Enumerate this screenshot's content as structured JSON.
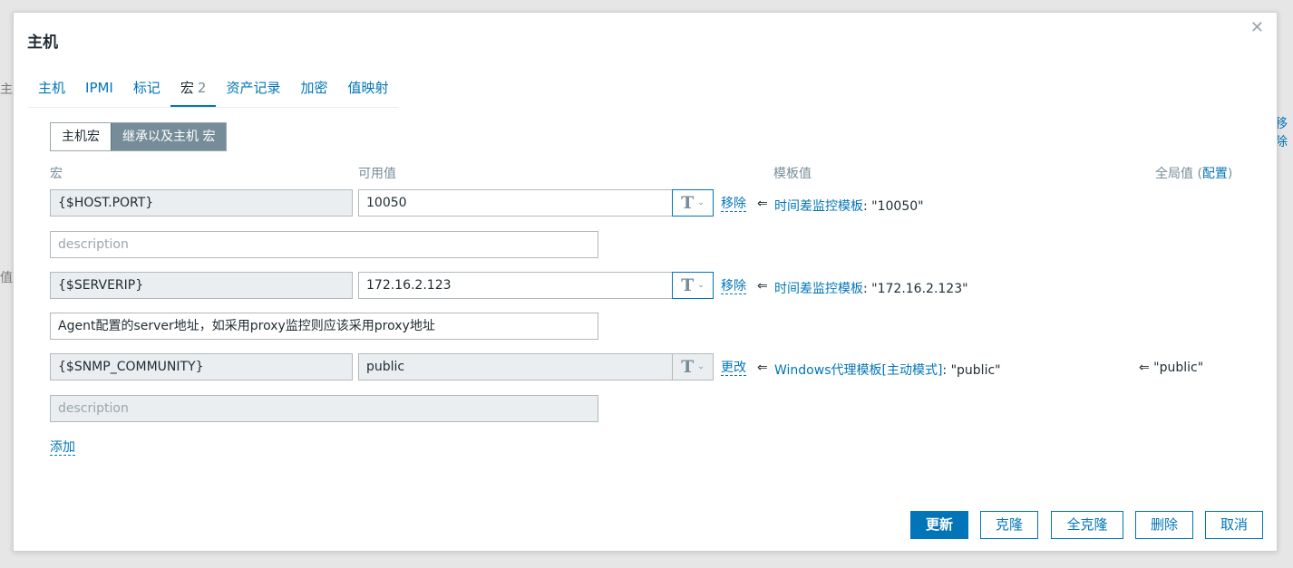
{
  "background": {
    "left_text_1": "主机",
    "left_text_2": "值",
    "right_text": "移除"
  },
  "modal": {
    "title": "主机",
    "tabs": [
      {
        "label": "主机"
      },
      {
        "label": "IPMI"
      },
      {
        "label": "标记"
      },
      {
        "label": "宏",
        "count": "2"
      },
      {
        "label": "资产记录"
      },
      {
        "label": "加密"
      },
      {
        "label": "值映射"
      }
    ],
    "segment": {
      "host_macros": "主机宏",
      "inherited_macros": "继承以及主机 宏"
    },
    "headers": {
      "macro": "宏",
      "effective_value": "可用值",
      "template_value": "模板值",
      "global_value": "全局值",
      "config_link": "配置"
    },
    "rows": [
      {
        "macro": "{$HOST.PORT}",
        "value": "10050",
        "description": "",
        "description_placeholder": "description",
        "action": "移除",
        "arrow": "⇐",
        "template_name": "时间差监控模板",
        "template_value": ": \"10050\"",
        "global_value": ""
      },
      {
        "macro": "{$SERVERIP}",
        "value": "172.16.2.123",
        "description": "Agent配置的server地址，如采用proxy监控则应该采用proxy地址",
        "description_placeholder": "description",
        "action": "移除",
        "arrow": "⇐",
        "template_name": "时间差监控模板",
        "template_value": ": \"172.16.2.123\"",
        "global_value": ""
      },
      {
        "macro": "{$SNMP_COMMUNITY}",
        "value": "public",
        "description": "",
        "description_placeholder": "description",
        "action": "更改",
        "arrow": "⇐",
        "template_name": "Windows代理模板[主动模式]",
        "template_value": ": \"public\"",
        "global_value": "⇐ \"public\""
      }
    ],
    "add_link": "添加",
    "buttons": {
      "update": "更新",
      "clone": "克隆",
      "full_clone": "全克隆",
      "delete": "删除",
      "cancel": "取消"
    },
    "icons": {
      "close": "close-icon",
      "text_type": "text-type-icon",
      "chevron": "chevron-down-icon"
    },
    "colors": {
      "accent": "#0275b8",
      "muted": "#768d99",
      "readonly_bg": "#ebeef0"
    }
  }
}
